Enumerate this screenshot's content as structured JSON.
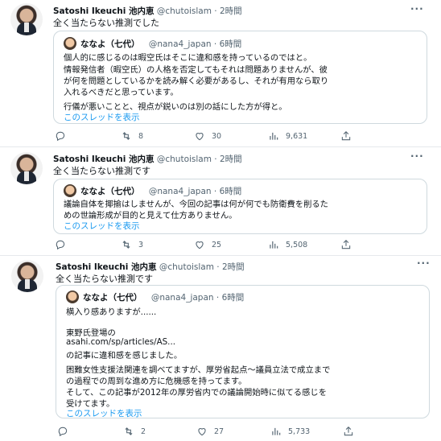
{
  "tweets": [
    {
      "author_name": "Satoshi Ikeuchi 池内恵",
      "handle_time": "@chutoislam · 2時間",
      "text": "全く当たらない推測でした",
      "quote": {
        "author_name": "ななよ（七代）",
        "handle_time": "@nana4_japan · 6時間",
        "lines": [
          "個人的に感じるのは暇空氏はそこに違和感を持っているのではと。",
          "情報発信者（暇空氏）の人格を否定してもそれは問題ありませんが、彼",
          "が何を問題としているかを読み解く必要があるし、それが有用なら取り",
          "入れるべきだと思っています。",
          "",
          "行儀が悪いことと、視点が鋭いのは別の話にした方が得と。"
        ],
        "thread_link": "このスレッドを表示"
      },
      "stats": {
        "replies": "",
        "retweets": "8",
        "likes": "30",
        "views": "9,631"
      }
    },
    {
      "author_name": "Satoshi Ikeuchi 池内恵",
      "handle_time": "@chutoislam · 2時間",
      "text": "全く当たらない推測です",
      "quote": {
        "author_name": "ななよ（七代）",
        "handle_time": "@nana4_japan · 6時間",
        "lines": [
          "議論自体を揶揄はしませんが、今回の記事は何が何でも防衛費を削るた",
          "めの世論形成が目的と見えて仕方ありません。"
        ],
        "thread_link": "このスレッドを表示"
      },
      "stats": {
        "replies": "",
        "retweets": "3",
        "likes": "25",
        "views": "5,508"
      }
    },
    {
      "author_name": "Satoshi Ikeuchi 池内恵",
      "handle_time": "@chutoislam · 2時間",
      "text": "全く当たらない推測です",
      "quote": {
        "author_name": "ななよ（七代）",
        "handle_time": "@nana4_japan · 6時間",
        "lines": [
          "横入り感ありますが......",
          "",
          "東野氏登場の",
          "asahi.com/sp/articles/AS...",
          "の記事に違和感を感じました。",
          "",
          "困難女性支援法関連を調べてますが、厚労省起点～議員立法で成立まで",
          "の過程での周到な進め方に危機感を持ってます。",
          "そして、この記事が2012年の厚労省内での議論開始時に似てる感じを",
          "受けてます。"
        ],
        "thread_link": "このスレッドを表示"
      },
      "stats": {
        "replies": "",
        "retweets": "2",
        "likes": "27",
        "views": "5,733"
      }
    }
  ],
  "icons": {
    "reply": "reply-icon",
    "retweet": "retweet-icon",
    "like": "heart-icon",
    "views": "views-icon",
    "share": "share-icon",
    "more": "more-dots-icon"
  },
  "more_label": "···",
  "colors": {
    "link": "#1d9bf0",
    "muted": "#536471",
    "border": "#cfd9de"
  }
}
